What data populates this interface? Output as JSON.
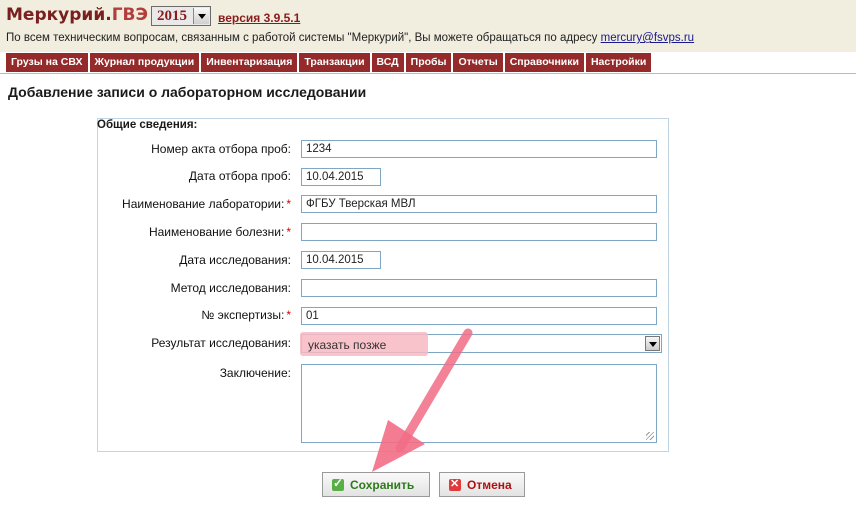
{
  "header": {
    "app_name": "Меркурий.",
    "app_suffix": "ГВЭ",
    "year": "2015",
    "version": "версия 3.9.5.1",
    "support_text": "По всем техническим вопросам, связанным с работой системы \"Меркурий\", Вы можете обращаться по адресу ",
    "support_email": "mercury@fsvps.ru"
  },
  "nav": {
    "items": [
      "Грузы на СВХ",
      "Журнал продукции",
      "Инвентаризация",
      "Транзакции",
      "ВСД",
      "Пробы",
      "Отчеты",
      "Справочники",
      "Настройки"
    ]
  },
  "page": {
    "title": "Добавление записи о лабораторном исследовании",
    "section": "Общие сведения:"
  },
  "form": {
    "act_number_label": "Номер акта отбора проб:",
    "act_number_value": "1234",
    "sample_date_label": "Дата отбора проб:",
    "sample_date_value": "10.04.2015",
    "lab_name_label": "Наименование лаборатории:",
    "lab_name_value": "ФГБУ Тверская МВЛ",
    "disease_label": "Наименование болезни:",
    "disease_value": "",
    "research_date_label": "Дата исследования:",
    "research_date_value": "10.04.2015",
    "method_label": "Метод исследования:",
    "method_value": "",
    "expertise_label": "№ экспертизы:",
    "expertise_value": "01",
    "result_label": "Результат исследования:",
    "result_value": "указать позже",
    "conclusion_label": "Заключение:",
    "required_mark": "*"
  },
  "buttons": {
    "save": "Сохранить",
    "cancel": "Отмена"
  },
  "colors": {
    "brand": "#952a2a",
    "highlight": "#f7b8c2",
    "annotation_arrow": "#f26d86"
  },
  "icons": {
    "save": "check-icon",
    "cancel": "x-icon",
    "dropdown": "chevron-down-icon"
  }
}
